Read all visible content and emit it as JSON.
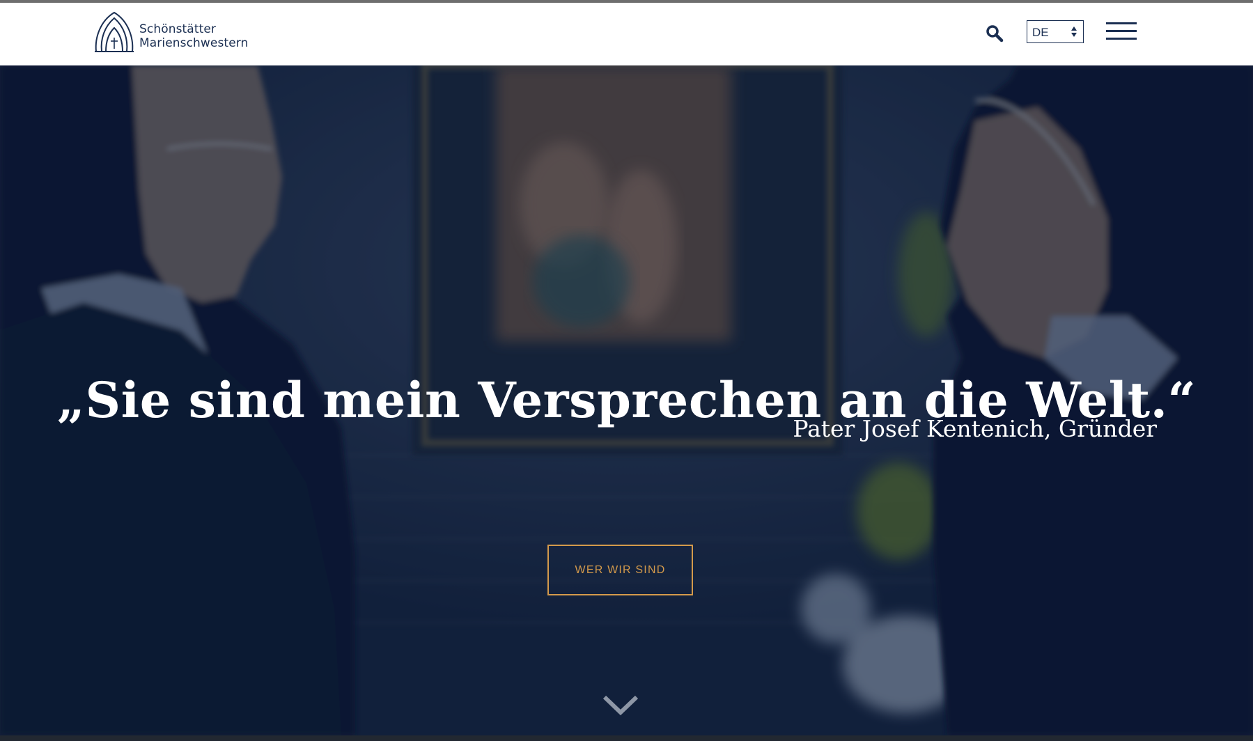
{
  "brand": {
    "name_line1": "Schönstätter",
    "name_line2": "Marienschwestern",
    "logo_icon": "shrine-logo-icon",
    "color": "#1b2f52"
  },
  "header": {
    "search_icon": "search-icon",
    "language": {
      "selected": "DE",
      "arrows_icon": "sort-arrows-icon"
    },
    "menu_icon": "hamburger-menu-icon"
  },
  "hero": {
    "quote": "„Sie sind mein Versprechen an die Welt.“",
    "author": "Pater Josef Kentenich, Gründer",
    "cta_label": "WER WIR SIND",
    "cta_color": "#d49a4b",
    "scroll_icon": "chevron-down-icon"
  }
}
